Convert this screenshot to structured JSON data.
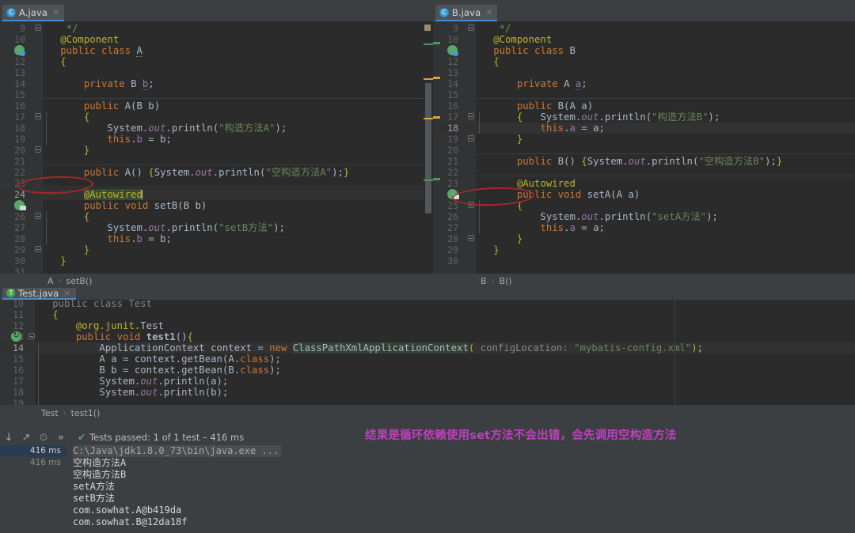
{
  "window": {
    "title": "IntelliJ IDEA - Spring circular dependency demo"
  },
  "editors": {
    "left": {
      "tab": {
        "label": "A.java",
        "icon": "java-class-icon",
        "close": "×"
      },
      "breadcrumb": [
        "A",
        "setB()"
      ],
      "first_line": 9,
      "current_line": 24,
      "lines": [
        {
          "n": 9,
          "tokens": [
            {
              "t": "    */",
              "c": "cmt2"
            }
          ]
        },
        {
          "n": 10,
          "tokens": [
            {
              "t": "   @Component",
              "c": "ann"
            }
          ]
        },
        {
          "n": 11,
          "tokens": [
            {
              "t": "   ",
              "c": "typ"
            },
            {
              "t": "public class ",
              "c": "kw"
            },
            {
              "t": "A",
              "c": "typ under"
            }
          ]
        },
        {
          "n": 12,
          "tokens": [
            {
              "t": "   {",
              "c": "ann"
            }
          ]
        },
        {
          "n": 13,
          "tokens": []
        },
        {
          "n": 14,
          "tokens": [
            {
              "t": "       ",
              "c": "typ"
            },
            {
              "t": "private ",
              "c": "kw"
            },
            {
              "t": "B ",
              "c": "typ"
            },
            {
              "t": "b",
              "c": "fld under"
            },
            {
              "t": ";",
              "c": "typ"
            }
          ]
        },
        {
          "n": 15,
          "tokens": []
        },
        {
          "n": 16,
          "tokens": [
            {
              "t": "       ",
              "c": "typ"
            },
            {
              "t": "public ",
              "c": "kw"
            },
            {
              "t": "A(",
              "c": "typ"
            },
            {
              "t": "B b",
              "c": "typ"
            },
            {
              "t": ")",
              "c": "typ"
            }
          ]
        },
        {
          "n": 17,
          "tokens": [
            {
              "t": "       {",
              "c": "ann"
            }
          ]
        },
        {
          "n": 18,
          "tokens": [
            {
              "t": "           System.",
              "c": "typ"
            },
            {
              "t": "out",
              "c": "sfld"
            },
            {
              "t": ".println(",
              "c": "typ"
            },
            {
              "t": "\"构造方法A\"",
              "c": "str"
            },
            {
              "t": ");",
              "c": "typ"
            }
          ]
        },
        {
          "n": 19,
          "tokens": [
            {
              "t": "           ",
              "c": "typ"
            },
            {
              "t": "this",
              "c": "kw"
            },
            {
              "t": ".",
              "c": "typ"
            },
            {
              "t": "b",
              "c": "fld"
            },
            {
              "t": " = b;",
              "c": "typ"
            }
          ]
        },
        {
          "n": 20,
          "tokens": [
            {
              "t": "       }",
              "c": "ann"
            }
          ]
        },
        {
          "n": 21,
          "tokens": []
        },
        {
          "n": 22,
          "tokens": [
            {
              "t": "       ",
              "c": "typ"
            },
            {
              "t": "public ",
              "c": "kw"
            },
            {
              "t": "A() ",
              "c": "typ"
            },
            {
              "t": "{",
              "c": "ann"
            },
            {
              "t": "System.",
              "c": "typ"
            },
            {
              "t": "out",
              "c": "sfld"
            },
            {
              "t": ".println(",
              "c": "typ"
            },
            {
              "t": "\"空构造方法A\"",
              "c": "str"
            },
            {
              "t": ");",
              "c": "typ"
            },
            {
              "t": "}",
              "c": "ann"
            }
          ]
        },
        {
          "n": 23,
          "tokens": []
        },
        {
          "n": 24,
          "tokens": [
            {
              "t": "       ",
              "c": "typ"
            },
            {
              "t": "@Autowired",
              "c": "ann sel"
            }
          ]
        },
        {
          "n": 25,
          "tokens": [
            {
              "t": "       ",
              "c": "typ"
            },
            {
              "t": "public void ",
              "c": "kw"
            },
            {
              "t": "setB(",
              "c": "typ"
            },
            {
              "t": "B b",
              "c": "typ"
            },
            {
              "t": ")",
              "c": "typ"
            }
          ]
        },
        {
          "n": 26,
          "tokens": [
            {
              "t": "       {",
              "c": "ann"
            }
          ]
        },
        {
          "n": 27,
          "tokens": [
            {
              "t": "           System.",
              "c": "typ"
            },
            {
              "t": "out",
              "c": "sfld"
            },
            {
              "t": ".println(",
              "c": "typ"
            },
            {
              "t": "\"setB方法\"",
              "c": "str"
            },
            {
              "t": ");",
              "c": "typ"
            }
          ]
        },
        {
          "n": 28,
          "tokens": [
            {
              "t": "           ",
              "c": "typ"
            },
            {
              "t": "this",
              "c": "kw"
            },
            {
              "t": ".",
              "c": "typ"
            },
            {
              "t": "b",
              "c": "fld"
            },
            {
              "t": " = b;",
              "c": "typ"
            }
          ]
        },
        {
          "n": 29,
          "tokens": [
            {
              "t": "       }",
              "c": "ann"
            }
          ]
        },
        {
          "n": 30,
          "tokens": [
            {
              "t": "   }",
              "c": "ann"
            }
          ]
        },
        {
          "n": 31,
          "tokens": []
        }
      ],
      "annotation_ellipse": "red-ellipse-autowired"
    },
    "right": {
      "tab": {
        "label": "B.java",
        "icon": "java-class-icon",
        "close": "×"
      },
      "breadcrumb": [
        "B",
        "B()"
      ],
      "first_line": 9,
      "current_line": 18,
      "lines": [
        {
          "n": 9,
          "tokens": [
            {
              "t": "    */",
              "c": "cmt2"
            }
          ]
        },
        {
          "n": 10,
          "tokens": [
            {
              "t": "   @Component",
              "c": "ann"
            }
          ]
        },
        {
          "n": 11,
          "tokens": [
            {
              "t": "   ",
              "c": "typ"
            },
            {
              "t": "public class ",
              "c": "kw"
            },
            {
              "t": "B",
              "c": "typ"
            }
          ]
        },
        {
          "n": 12,
          "tokens": [
            {
              "t": "   {",
              "c": "ann"
            }
          ]
        },
        {
          "n": 13,
          "tokens": []
        },
        {
          "n": 14,
          "tokens": [
            {
              "t": "       ",
              "c": "typ"
            },
            {
              "t": "private ",
              "c": "kw"
            },
            {
              "t": "A ",
              "c": "typ"
            },
            {
              "t": "a",
              "c": "fld under"
            },
            {
              "t": ";",
              "c": "typ"
            }
          ]
        },
        {
          "n": 15,
          "tokens": []
        },
        {
          "n": 16,
          "tokens": [
            {
              "t": "       ",
              "c": "typ"
            },
            {
              "t": "public ",
              "c": "kw"
            },
            {
              "t": "B(",
              "c": "typ"
            },
            {
              "t": "A a",
              "c": "typ"
            },
            {
              "t": ")",
              "c": "typ"
            }
          ]
        },
        {
          "n": 17,
          "tokens": [
            {
              "t": "       {",
              "c": "ann"
            },
            {
              "t": "   System.",
              "c": "typ"
            },
            {
              "t": "out",
              "c": "sfld"
            },
            {
              "t": ".println(",
              "c": "typ"
            },
            {
              "t": "\"构造方法B\"",
              "c": "str"
            },
            {
              "t": ");",
              "c": "typ"
            }
          ]
        },
        {
          "n": 18,
          "tokens": [
            {
              "t": "           ",
              "c": "typ"
            },
            {
              "t": "this",
              "c": "kw"
            },
            {
              "t": ".",
              "c": "typ"
            },
            {
              "t": "a",
              "c": "fld"
            },
            {
              "t": " = a;",
              "c": "typ"
            }
          ]
        },
        {
          "n": 19,
          "tokens": [
            {
              "t": "       }",
              "c": "ann"
            }
          ]
        },
        {
          "n": 20,
          "tokens": []
        },
        {
          "n": 21,
          "tokens": [
            {
              "t": "       ",
              "c": "typ"
            },
            {
              "t": "public ",
              "c": "kw"
            },
            {
              "t": "B() ",
              "c": "typ"
            },
            {
              "t": "{",
              "c": "ann"
            },
            {
              "t": "System.",
              "c": "typ"
            },
            {
              "t": "out",
              "c": "sfld"
            },
            {
              "t": ".println(",
              "c": "typ"
            },
            {
              "t": "\"空构造方法B\"",
              "c": "str"
            },
            {
              "t": ");",
              "c": "typ"
            },
            {
              "t": "}",
              "c": "ann"
            }
          ]
        },
        {
          "n": 22,
          "tokens": []
        },
        {
          "n": 23,
          "tokens": [
            {
              "t": "       ",
              "c": "typ"
            },
            {
              "t": "@Autowired",
              "c": "ann"
            }
          ]
        },
        {
          "n": 24,
          "tokens": [
            {
              "t": "       ",
              "c": "typ"
            },
            {
              "t": "public void ",
              "c": "kw"
            },
            {
              "t": "setA(",
              "c": "typ"
            },
            {
              "t": "A a",
              "c": "typ"
            },
            {
              "t": ")",
              "c": "typ"
            }
          ]
        },
        {
          "n": 25,
          "tokens": [
            {
              "t": "       {",
              "c": "ann"
            }
          ]
        },
        {
          "n": 26,
          "tokens": [
            {
              "t": "           System.",
              "c": "typ"
            },
            {
              "t": "out",
              "c": "sfld"
            },
            {
              "t": ".println(",
              "c": "typ"
            },
            {
              "t": "\"setA方法\"",
              "c": "str"
            },
            {
              "t": ");",
              "c": "typ"
            }
          ]
        },
        {
          "n": 27,
          "tokens": [
            {
              "t": "           ",
              "c": "typ"
            },
            {
              "t": "this",
              "c": "kw"
            },
            {
              "t": ".",
              "c": "typ"
            },
            {
              "t": "a",
              "c": "fld"
            },
            {
              "t": " = a;",
              "c": "typ"
            }
          ]
        },
        {
          "n": 28,
          "tokens": [
            {
              "t": "       }",
              "c": "ann"
            }
          ]
        },
        {
          "n": 29,
          "tokens": [
            {
              "t": "   }",
              "c": "ann"
            }
          ]
        },
        {
          "n": 30,
          "tokens": []
        }
      ],
      "annotation_ellipse": "red-ellipse-autowired"
    },
    "bottom": {
      "tab": {
        "label": "Test.java",
        "icon": "junit-test-icon",
        "close": "×"
      },
      "breadcrumb": [
        "Test",
        "test1()"
      ],
      "first_line": 10,
      "current_line": 14,
      "lines": [
        {
          "n": 10,
          "tokens": [
            {
              "t": "   public class Test",
              "c": "cmt"
            }
          ]
        },
        {
          "n": 11,
          "tokens": [
            {
              "t": "   {",
              "c": "ann"
            }
          ]
        },
        {
          "n": 12,
          "tokens": [
            {
              "t": "       @org.junit.",
              "c": "ann"
            },
            {
              "t": "Test",
              "c": "typ"
            }
          ]
        },
        {
          "n": 13,
          "tokens": [
            {
              "t": "       ",
              "c": "typ"
            },
            {
              "t": "public void ",
              "c": "kw"
            },
            {
              "t": "test1",
              "c": "typ bold"
            },
            {
              "t": "()",
              "c": "typ"
            },
            {
              "t": "{",
              "c": "ann"
            }
          ]
        },
        {
          "n": 14,
          "tokens": [
            {
              "t": "           ApplicationContext context = ",
              "c": "typ"
            },
            {
              "t": "new ",
              "c": "kw"
            },
            {
              "t": "ClassPathXmlApplicationContext",
              "c": "typ chip"
            },
            {
              "t": "(",
              "c": "ann"
            },
            {
              "t": " configLocation: ",
              "c": "hint"
            },
            {
              "t": "\"mybatis-config.xml\"",
              "c": "str"
            },
            {
              "t": ")",
              "c": "ann"
            },
            {
              "t": ";",
              "c": "typ"
            }
          ]
        },
        {
          "n": 15,
          "tokens": [
            {
              "t": "           A a = context.getBean(",
              "c": "typ"
            },
            {
              "t": "A",
              "c": "typ"
            },
            {
              "t": ".",
              "c": "typ"
            },
            {
              "t": "class",
              "c": "kw"
            },
            {
              "t": ");",
              "c": "typ"
            }
          ]
        },
        {
          "n": 16,
          "tokens": [
            {
              "t": "           B b = context.getBean(",
              "c": "typ"
            },
            {
              "t": "B",
              "c": "typ"
            },
            {
              "t": ".",
              "c": "typ"
            },
            {
              "t": "class",
              "c": "kw"
            },
            {
              "t": ");",
              "c": "typ"
            }
          ]
        },
        {
          "n": 17,
          "tokens": [
            {
              "t": "           System.",
              "c": "typ"
            },
            {
              "t": "out",
              "c": "sfld"
            },
            {
              "t": ".println(a);",
              "c": "typ"
            }
          ]
        },
        {
          "n": 18,
          "tokens": [
            {
              "t": "           System.",
              "c": "typ"
            },
            {
              "t": "out",
              "c": "sfld"
            },
            {
              "t": ".println(b);",
              "c": "typ"
            }
          ]
        },
        {
          "n": 19,
          "tokens": []
        }
      ]
    }
  },
  "run_panel": {
    "toolbar_icons": [
      "scroll-down-icon",
      "expand-icon",
      "history-icon",
      "more-icon"
    ],
    "more_label": "»",
    "status_check": "✔",
    "status_text": "Tests passed: 1 of 1 test – 416 ms",
    "timings": [
      "416 ms",
      "416 ms"
    ],
    "console_lines": [
      {
        "text": "C:\\Java\\jdk1.8.0_73\\bin\\java.exe ...",
        "kind": "command"
      },
      {
        "text": "空构造方法A",
        "kind": "out"
      },
      {
        "text": "空构造方法B",
        "kind": "out"
      },
      {
        "text": "setA方法",
        "kind": "out"
      },
      {
        "text": "setB方法",
        "kind": "out"
      },
      {
        "text": "com.sowhat.A@b419da",
        "kind": "out"
      },
      {
        "text": "com.sowhat.B@12da18f",
        "kind": "out"
      }
    ]
  },
  "annotation": {
    "text": "结果是循环依赖使用set方法不会出错，会先调用空构造方法",
    "color": "#c23ec2"
  },
  "colors": {
    "editor_bg": "#2b2b2b",
    "gutter_bg": "#313335",
    "chrome_bg": "#3c3f41",
    "tab_active": "#4e5254",
    "tab_underline": "#4a88c7",
    "keyword": "#cc7832",
    "string": "#6a8759",
    "annotation": "#bbb529",
    "field": "#9876aa",
    "text": "#a9b7c6",
    "marker_red": "#a32a2a",
    "passed_green": "#59a869"
  }
}
